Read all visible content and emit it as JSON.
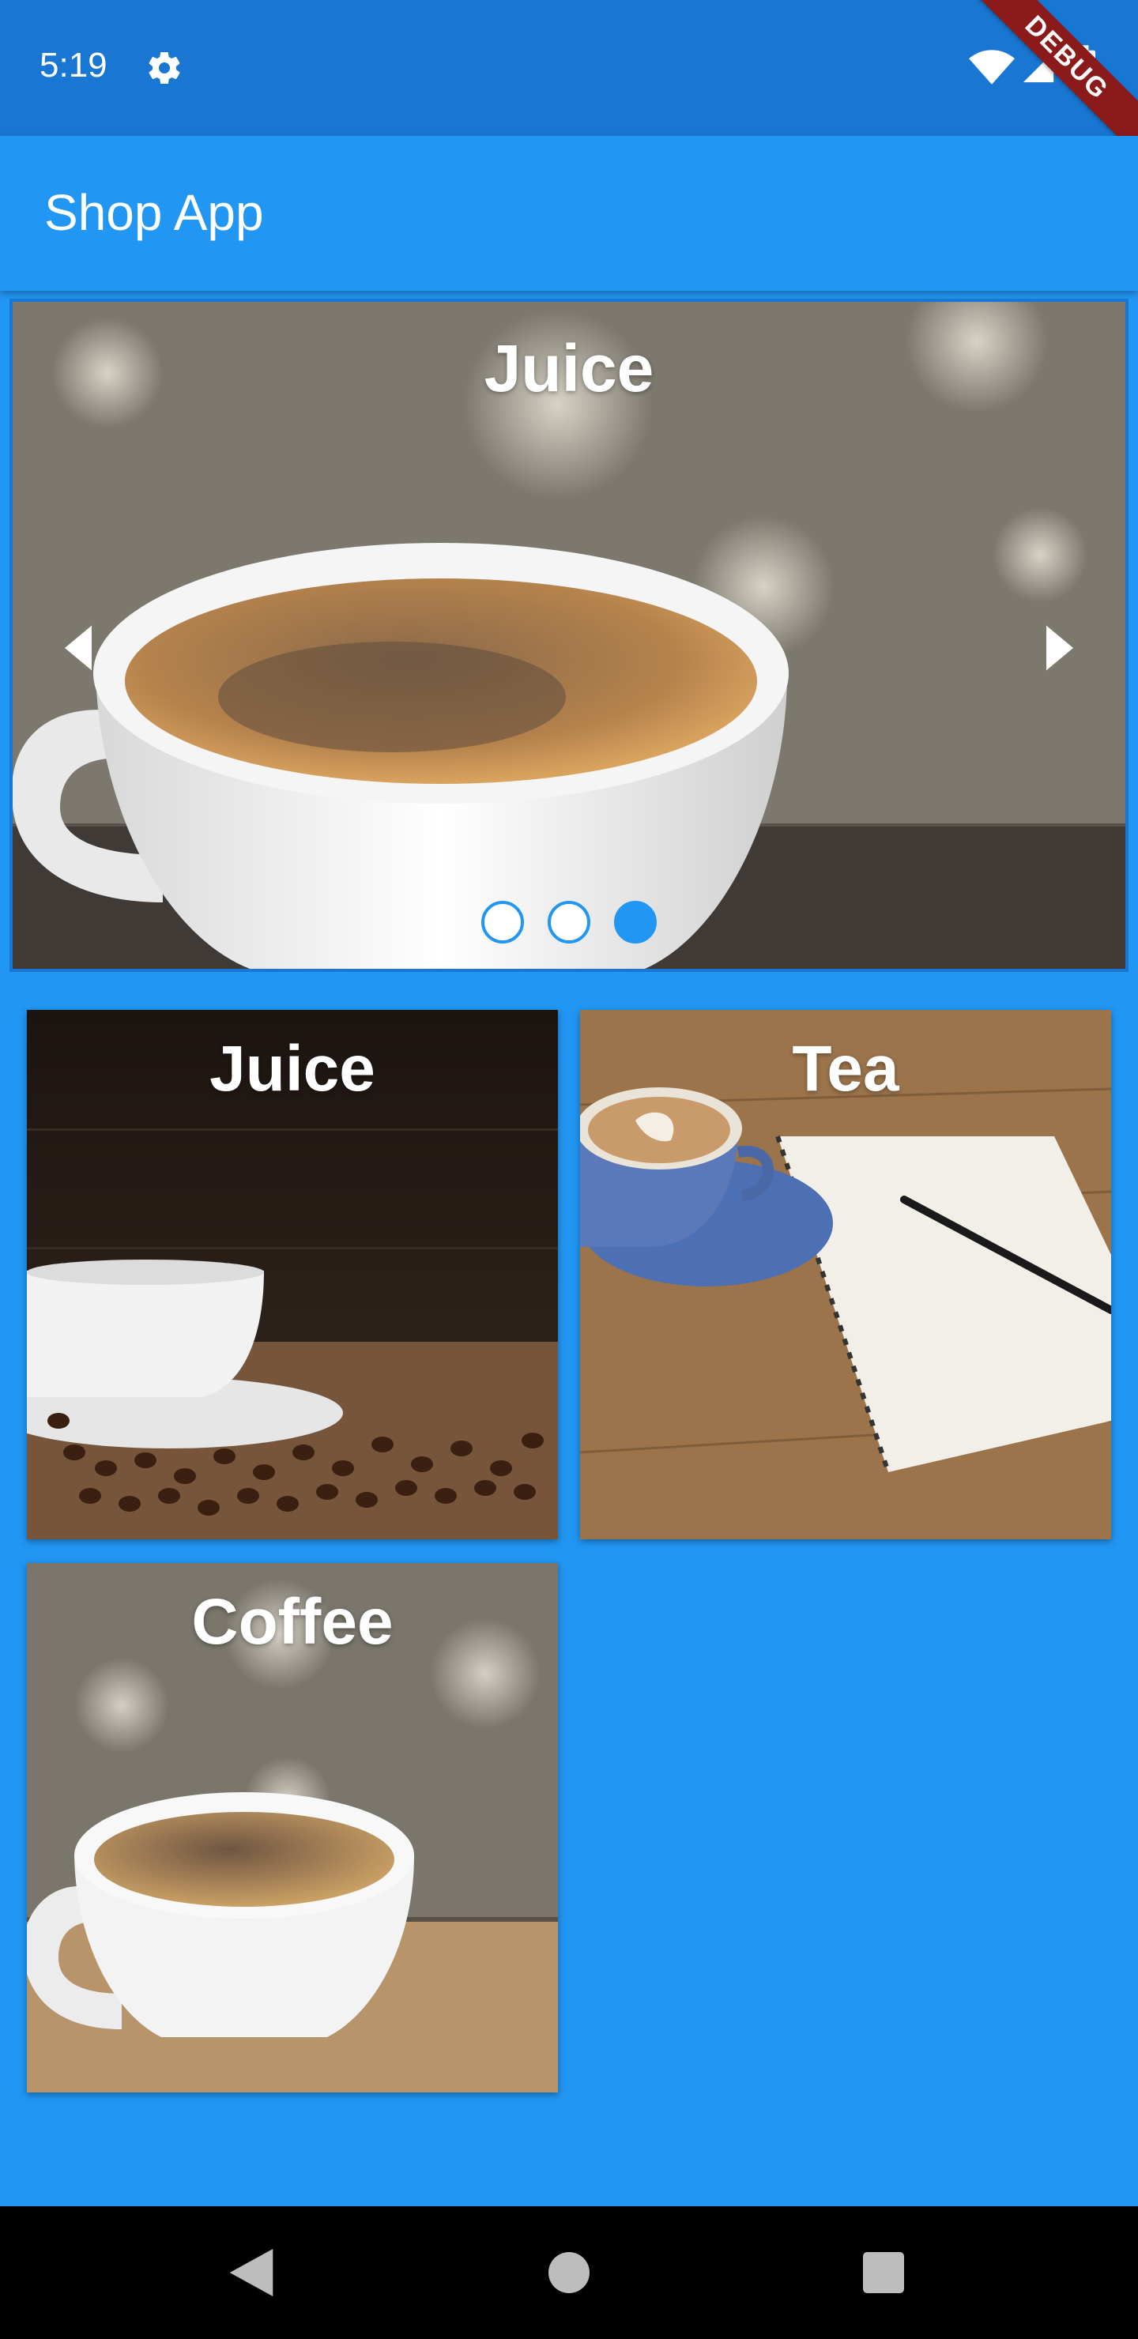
{
  "status_bar": {
    "time": "5:19",
    "icons": [
      "gear-icon",
      "wifi-icon",
      "signal-icon",
      "battery-icon"
    ]
  },
  "debug_banner": "DEBUG",
  "app_bar": {
    "title": "Shop App"
  },
  "carousel": {
    "title": "Juice",
    "dots": 3,
    "active_dot": 3
  },
  "grid": {
    "tiles": [
      {
        "title": "Juice"
      },
      {
        "title": "Tea"
      },
      {
        "title": "Coffee"
      }
    ]
  },
  "colors": {
    "primary": "#2196F3",
    "status_bar": "#1976D2",
    "debug": "#8B1A1A"
  }
}
